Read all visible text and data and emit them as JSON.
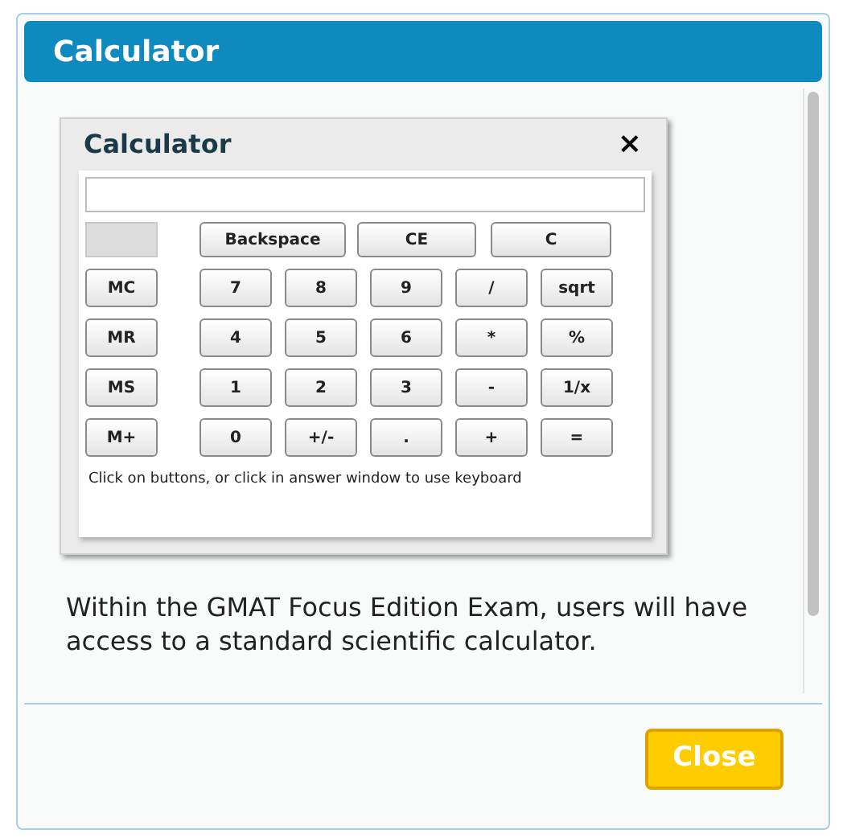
{
  "dialog": {
    "title": "Calculator"
  },
  "calculator": {
    "title": "Calculator",
    "close": "×",
    "top_keys": [
      "Backspace",
      "CE",
      "C"
    ],
    "memory_keys": [
      "MC",
      "MR",
      "MS",
      "M+"
    ],
    "key_rows": [
      [
        "7",
        "8",
        "9",
        "/",
        "sqrt"
      ],
      [
        "4",
        "5",
        "6",
        "*",
        "%"
      ],
      [
        "1",
        "2",
        "3",
        "-",
        "1/x"
      ],
      [
        "0",
        "+/-",
        ".",
        "+",
        "="
      ]
    ],
    "hint": "Click on buttons, or click in answer window to use keyboard"
  },
  "body_text": "Within the GMAT Focus Edition Exam, users will have access to a standard scientific calculator.",
  "buttons": [
    "Close"
  ]
}
